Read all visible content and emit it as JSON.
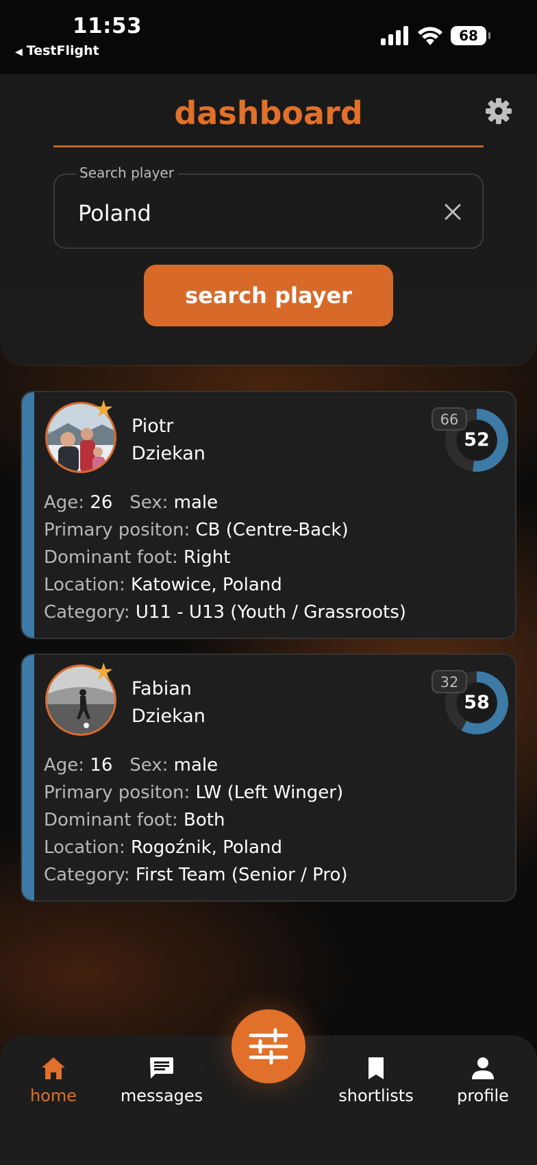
{
  "status_bar": {
    "time": "11:53",
    "back_label": "TestFlight",
    "battery": "68"
  },
  "header": {
    "title": "dashboard",
    "search": {
      "label": "Search player",
      "value": "Poland"
    },
    "search_button": "search player"
  },
  "players": [
    {
      "first_name": "Piotr",
      "last_name": "Dziekan",
      "badge": "66",
      "score": "52",
      "score_fraction": 0.52,
      "age_label": "Age:",
      "age": "26",
      "sex_label": "Sex:",
      "sex": "male",
      "position_label": "Primary positon:",
      "position": "CB (Centre-Back)",
      "foot_label": "Dominant foot:",
      "foot": "Right",
      "location_label": "Location:",
      "location": "Katowice, Poland",
      "category_label": "Category:",
      "category": "U11 - U13 (Youth / Grassroots)"
    },
    {
      "first_name": "Fabian",
      "last_name": "Dziekan",
      "badge": "32",
      "score": "58",
      "score_fraction": 0.58,
      "age_label": "Age:",
      "age": "16",
      "sex_label": "Sex:",
      "sex": "male",
      "position_label": "Primary positon:",
      "position": "LW (Left Winger)",
      "foot_label": "Dominant foot:",
      "foot": "Both",
      "location_label": "Location:",
      "location": "Rogoźnik, Poland",
      "category_label": "Category:",
      "category": "First Team (Senior / Pro)"
    }
  ],
  "nav": {
    "home": "home",
    "messages": "messages",
    "shortlists": "shortlists",
    "profile": "profile",
    "active": "home",
    "icons": [
      "home-icon",
      "message-icon",
      "filter-sliders-icon",
      "bookmark-icon",
      "person-icon"
    ]
  },
  "colors": {
    "accent": "#e0702a",
    "card_stripe": "#3d7aa6",
    "ring_fill": "#3d7aa6",
    "star": "#f2a93b"
  }
}
